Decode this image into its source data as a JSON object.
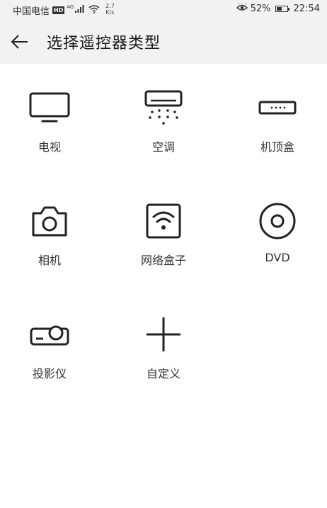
{
  "status_bar": {
    "carrier": "中国电信",
    "hd_badge": "HD",
    "network_tag": "4G",
    "net_speed_value": "2.7",
    "net_speed_unit": "K/s",
    "battery": "52%",
    "battery_level": 0.52,
    "time": "22:54"
  },
  "header": {
    "title": "选择遥控器类型",
    "back_icon": "arrow-left-icon"
  },
  "devices": [
    {
      "label": "电视",
      "icon": "tv-icon"
    },
    {
      "label": "空调",
      "icon": "air-conditioner-icon"
    },
    {
      "label": "机顶盒",
      "icon": "set-top-box-icon"
    },
    {
      "label": "相机",
      "icon": "camera-icon"
    },
    {
      "label": "网络盒子",
      "icon": "network-box-icon"
    },
    {
      "label": "DVD",
      "icon": "dvd-icon"
    },
    {
      "label": "投影仪",
      "icon": "projector-icon"
    },
    {
      "label": "自定义",
      "icon": "plus-icon"
    }
  ],
  "colors": {
    "header_bg": "#f2f2f2",
    "icon": "#222222",
    "label": "#333333"
  }
}
